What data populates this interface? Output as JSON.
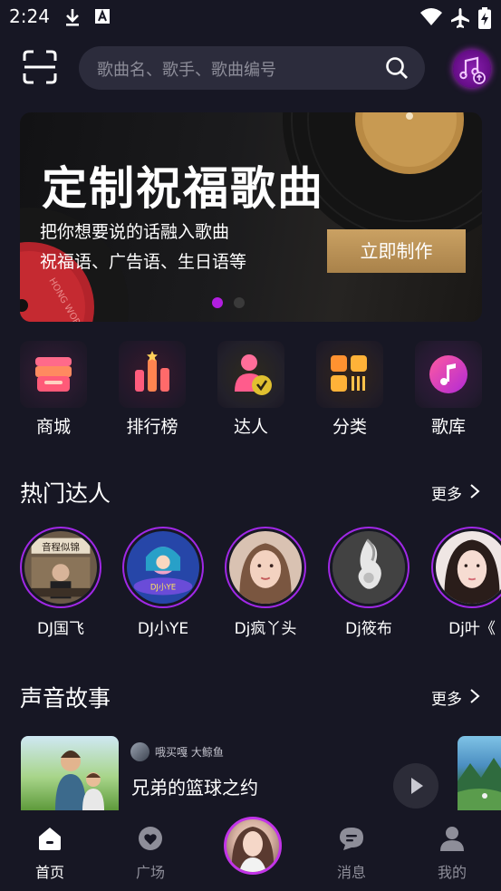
{
  "status_bar": {
    "time": "2:24",
    "icons": [
      "download-icon",
      "text-a-icon",
      "wifi-icon",
      "airplane-icon",
      "battery-charging-icon"
    ]
  },
  "header": {
    "scan_icon": "scan-icon",
    "search": {
      "placeholder": "歌曲名、歌手、歌曲编号",
      "icon": "search-icon"
    },
    "music_upload_icon": "music-upload-icon"
  },
  "banner": {
    "title": "定制祝福歌曲",
    "subtitle_line1": "把你想要说的话融入歌曲",
    "subtitle_line2": "祝福语、广告语、生日语等",
    "cta_label": "立即制作",
    "record_label_text": "HONG WORLD",
    "dots_count": 2,
    "active_dot": 0
  },
  "quick_nav": [
    {
      "label": "商城",
      "icon": "store-icon"
    },
    {
      "label": "排行榜",
      "icon": "ranking-icon"
    },
    {
      "label": "达人",
      "icon": "verified-user-icon"
    },
    {
      "label": "分类",
      "icon": "category-icon"
    },
    {
      "label": "歌库",
      "icon": "music-note-icon"
    }
  ],
  "hot_creators": {
    "title": "热门达人",
    "more_label": "更多",
    "items": [
      {
        "name": "DJ国飞",
        "avatar_sign": "音程似锦"
      },
      {
        "name": "DJ小YE",
        "avatar_sign": "DJ小YE"
      },
      {
        "name": "Dj疯丫头"
      },
      {
        "name": "Dj筱布"
      },
      {
        "name": "Dj叶《"
      }
    ]
  },
  "sound_stories": {
    "title": "声音故事",
    "more_label": "更多",
    "items": [
      {
        "author": "哦买嘎 大鲸鱼",
        "title": "兄弟的篮球之约"
      }
    ]
  },
  "tab_bar": {
    "active_color": "#ffffff",
    "inactive_color": "#8e8e99",
    "tabs": [
      {
        "label": "首页",
        "icon": "home-icon",
        "active": true
      },
      {
        "label": "广场",
        "icon": "plaza-icon",
        "active": false
      },
      {
        "label": "",
        "icon": "avatar-center",
        "active": false
      },
      {
        "label": "消息",
        "icon": "message-icon",
        "active": false
      },
      {
        "label": "我的",
        "icon": "profile-icon",
        "active": false
      }
    ]
  },
  "colors": {
    "background": "#171724",
    "accent_purple": "#a028e6",
    "gold_button": "#b98f55"
  }
}
